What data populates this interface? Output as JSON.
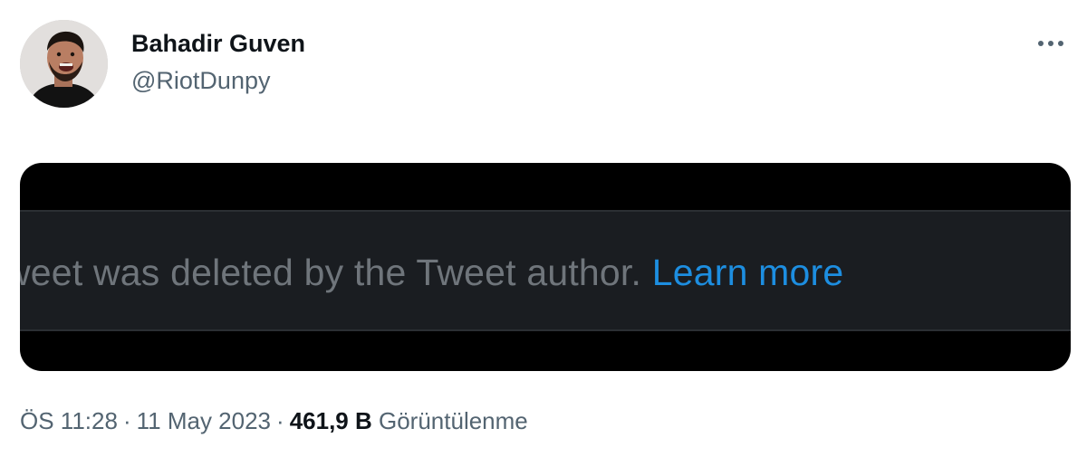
{
  "author": {
    "name": "Bahadir Guven",
    "handle": "@RiotDunpy"
  },
  "more_button": {
    "icon": "more-horizontal-icon",
    "glyph": "···"
  },
  "media": {
    "text": "weet was deleted by the Tweet author.",
    "link_text": "Learn more",
    "link_color": "#1d8ee0"
  },
  "meta": {
    "time": "ÖS 11:28",
    "separator": "·",
    "date": "11 May 2023",
    "views_count": "461,9 B",
    "views_label": "Görüntülenme"
  },
  "colors": {
    "text_primary": "#0f1419",
    "text_secondary": "#536471",
    "media_bg": "#000000",
    "banner_bg": "#1a1d21"
  }
}
